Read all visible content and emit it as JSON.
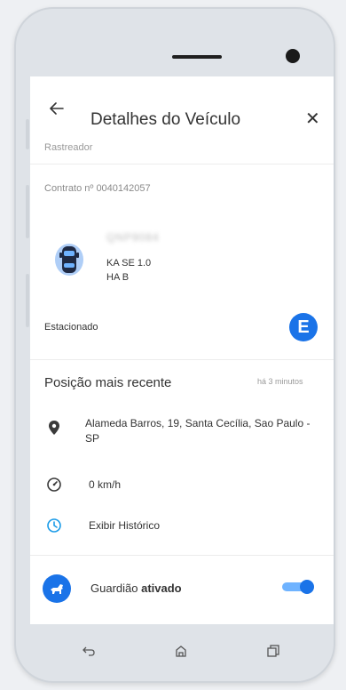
{
  "header": {
    "title": "Detalhes do Veículo",
    "back_icon": "arrow-left-icon",
    "close_label": "✕"
  },
  "faded_label": "Rastreador",
  "contract": "Contrato nº 0040142057",
  "vehicle": {
    "plate": "QNP9084",
    "model": "KA SE 1.0",
    "version": "HA B",
    "status": "Estacionado",
    "status_badge": "E",
    "accent_color": "#1a73e8"
  },
  "position": {
    "title": "Posição mais recente",
    "time": "há 3 minutos",
    "address": "Alameda Barros, 19, Santa Cecília, Sao Paulo - SP",
    "speed": "0 km/h",
    "history_label": "Exibir Histórico"
  },
  "guardian": {
    "prefix": "Guardião ",
    "state": "ativado",
    "enabled": true
  }
}
